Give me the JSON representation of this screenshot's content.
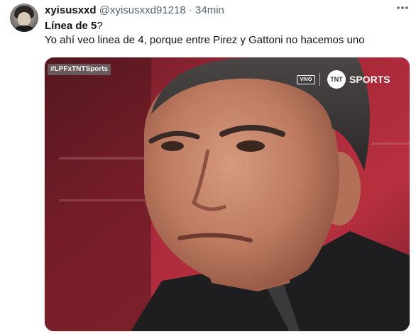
{
  "tweet": {
    "display_name": "xyisusxxd",
    "handle": "@xyisusxxd91218",
    "separator": "·",
    "time": "34min",
    "more_icon": "more-icon",
    "text_line1_bold": "Línea de 5",
    "text_line1_rest": "?",
    "text_line2": "Yo ahí veo linea de 4, porque entre Pirez y Gattoni no hacemos uno"
  },
  "media": {
    "tag": "#LPFxTNTSports",
    "live_badge": "VIVO",
    "logo_mark": "TNT",
    "logo_text": "SPORTS"
  },
  "colors": {
    "text_primary": "#0f1419",
    "text_secondary": "#536471",
    "background_red": "#b3263a"
  }
}
